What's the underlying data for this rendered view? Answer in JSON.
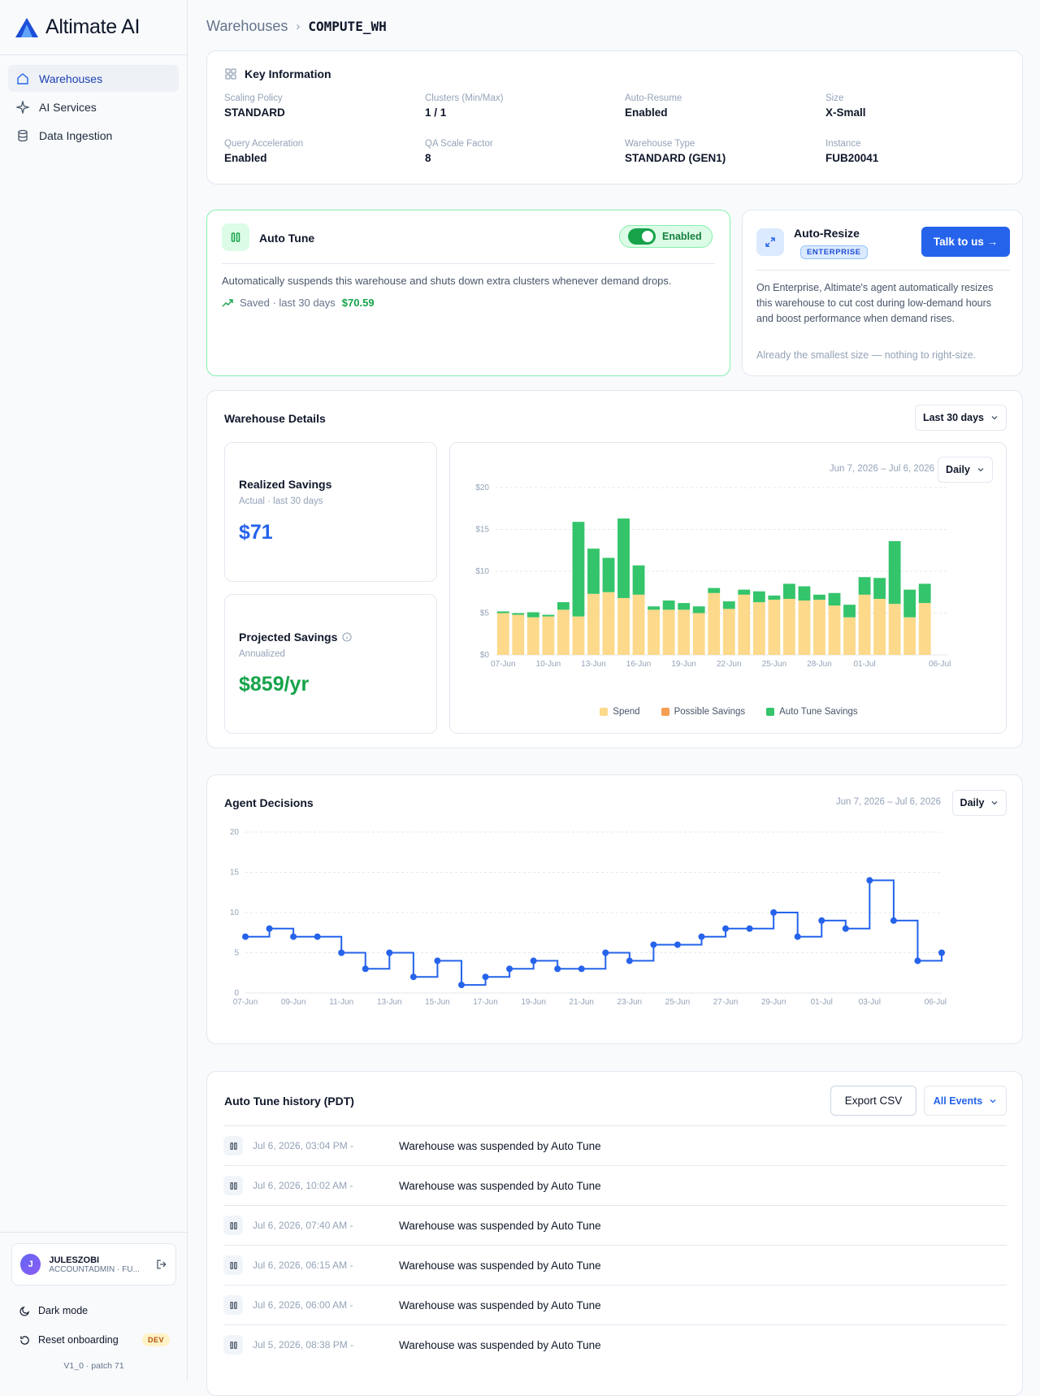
{
  "app": {
    "name": "Altimate AI"
  },
  "sidebar": {
    "items": [
      {
        "label": "Warehouses",
        "icon": "home-icon",
        "active": true
      },
      {
        "label": "AI Services",
        "icon": "sparkle-icon",
        "active": false
      },
      {
        "label": "Data Ingestion",
        "icon": "database-icon",
        "active": false
      }
    ],
    "user": {
      "initial": "J",
      "name": "JULESZOBI",
      "role": "ACCOUNTADMIN · FU..."
    },
    "dark_mode_label": "Dark mode",
    "reset_label": "Reset onboarding",
    "dev_badge": "DEV",
    "version": "V1_0 · patch 71"
  },
  "breadcrumb": {
    "root": "Warehouses",
    "current": "COMPUTE_WH"
  },
  "key_info": {
    "title": "Key Information",
    "fields": [
      {
        "label": "Scaling Policy",
        "value": "STANDARD"
      },
      {
        "label": "Clusters (Min/Max)",
        "value": "1 / 1"
      },
      {
        "label": "Auto-Resume",
        "value": "Enabled"
      },
      {
        "label": "Size",
        "value": "X-Small"
      },
      {
        "label": "Query Acceleration",
        "value": "Enabled"
      },
      {
        "label": "QA Scale Factor",
        "value": "8"
      },
      {
        "label": "Warehouse Type",
        "value": "STANDARD (GEN1)"
      },
      {
        "label": "Instance",
        "value": "FUB20041"
      }
    ]
  },
  "auto_tune": {
    "title": "Auto Tune",
    "toggle_label": "Enabled",
    "description": "Automatically suspends this warehouse and shuts down extra clusters whenever demand drops.",
    "saved_label": "Saved · last 30 days",
    "saved_value": "$70.59"
  },
  "auto_resize": {
    "title": "Auto-Resize",
    "badge": "ENTERPRISE",
    "button": "Talk to us →",
    "description": "On Enterprise, Altimate's agent automatically resizes this warehouse to cut cost during low-demand hours and boost performance when demand rises.",
    "note": "Already the smallest size — nothing to right-size."
  },
  "details": {
    "title": "Warehouse Details",
    "range_select": "Last 30 days",
    "realized": {
      "title": "Realized Savings",
      "sub": "Actual · last 30 days",
      "value": "$71"
    },
    "projected": {
      "title": "Projected Savings",
      "sub": "Annualized",
      "value": "$859/yr"
    },
    "chart_range": "Jun 7, 2026 – Jul 6, 2026",
    "granularity": "Daily"
  },
  "decisions": {
    "title": "Agent Decisions",
    "chart_range": "Jun 7, 2026 – Jul 6, 2026",
    "granularity": "Daily"
  },
  "history": {
    "title": "Auto Tune history (PDT)",
    "export_label": "Export CSV",
    "filter_label": "All Events",
    "rows": [
      {
        "time": "Jul 6, 2026, 03:04 PM -",
        "text": "Warehouse was suspended by Auto Tune"
      },
      {
        "time": "Jul 6, 2026, 10:02 AM -",
        "text": "Warehouse was suspended by Auto Tune"
      },
      {
        "time": "Jul 6, 2026, 07:40 AM -",
        "text": "Warehouse was suspended by Auto Tune"
      },
      {
        "time": "Jul 6, 2026, 06:15 AM -",
        "text": "Warehouse was suspended by Auto Tune"
      },
      {
        "time": "Jul 6, 2026, 06:00 AM -",
        "text": "Warehouse was suspended by Auto Tune"
      },
      {
        "time": "Jul 5, 2026, 08:38 PM -",
        "text": "Warehouse was suspended by Auto Tune"
      }
    ]
  },
  "colors": {
    "accent": "#2563eb",
    "spend": "#fcd98b",
    "possible": "#f59e52",
    "autotune": "#34c46b",
    "line": "#2563eb"
  },
  "chart_data": [
    {
      "type": "bar",
      "stacked": true,
      "categories": [
        "07-Jun",
        "08-Jun",
        "09-Jun",
        "10-Jun",
        "11-Jun",
        "12-Jun",
        "13-Jun",
        "14-Jun",
        "15-Jun",
        "16-Jun",
        "17-Jun",
        "18-Jun",
        "19-Jun",
        "20-Jun",
        "21-Jun",
        "22-Jun",
        "23-Jun",
        "24-Jun",
        "25-Jun",
        "26-Jun",
        "27-Jun",
        "28-Jun",
        "29-Jun",
        "30-Jun",
        "01-Jul",
        "02-Jul",
        "03-Jul",
        "04-Jul",
        "05-Jul",
        "06-Jul"
      ],
      "tick_labels": [
        "07-Jun",
        "10-Jun",
        "13-Jun",
        "16-Jun",
        "19-Jun",
        "22-Jun",
        "25-Jun",
        "28-Jun",
        "01-Jul",
        "06-Jul"
      ],
      "series": [
        {
          "name": "Spend",
          "values": [
            5.0,
            4.8,
            4.5,
            4.6,
            5.4,
            4.6,
            7.3,
            7.5,
            6.8,
            7.2,
            5.4,
            5.4,
            5.4,
            5.0,
            7.4,
            5.5,
            7.2,
            6.3,
            6.6,
            6.7,
            6.5,
            6.6,
            5.9,
            4.5,
            7.2,
            6.7,
            6.1,
            4.5,
            6.2,
            0
          ]
        },
        {
          "name": "Possible Savings",
          "values": [
            0,
            0,
            0,
            0,
            0,
            0,
            0,
            0,
            0,
            0,
            0,
            0,
            0,
            0,
            0,
            0,
            0,
            0,
            0,
            0,
            0,
            0,
            0,
            0,
            0,
            0,
            0,
            0,
            0,
            0
          ]
        },
        {
          "name": "Auto Tune Savings",
          "values": [
            0.2,
            0.2,
            0.6,
            0.2,
            0.9,
            11.3,
            5.4,
            4.1,
            9.5,
            3.5,
            0.4,
            1.1,
            0.8,
            0.8,
            0.6,
            0.9,
            0.6,
            1.3,
            0.5,
            1.8,
            1.7,
            0.6,
            1.5,
            1.5,
            2.1,
            2.5,
            7.5,
            3.3,
            2.3,
            0
          ]
        }
      ],
      "ylim": [
        0,
        20
      ],
      "yticks": [
        "$0",
        "$5",
        "$10",
        "$15",
        "$20"
      ],
      "legend": "bottom"
    },
    {
      "type": "line",
      "step": true,
      "x": [
        "07-Jun",
        "08-Jun",
        "09-Jun",
        "10-Jun",
        "11-Jun",
        "12-Jun",
        "13-Jun",
        "14-Jun",
        "15-Jun",
        "16-Jun",
        "17-Jun",
        "18-Jun",
        "19-Jun",
        "20-Jun",
        "21-Jun",
        "22-Jun",
        "23-Jun",
        "24-Jun",
        "25-Jun",
        "26-Jun",
        "27-Jun",
        "28-Jun",
        "29-Jun",
        "30-Jun",
        "01-Jul",
        "02-Jul",
        "03-Jul",
        "04-Jul",
        "05-Jul",
        "06-Jul"
      ],
      "tick_labels": [
        "07-Jun",
        "09-Jun",
        "11-Jun",
        "13-Jun",
        "15-Jun",
        "17-Jun",
        "19-Jun",
        "21-Jun",
        "23-Jun",
        "25-Jun",
        "27-Jun",
        "29-Jun",
        "01-Jul",
        "03-Jul",
        "06-Jul"
      ],
      "values": [
        7,
        8,
        7,
        7,
        5,
        3,
        5,
        2,
        4,
        1,
        2,
        3,
        4,
        3,
        3,
        5,
        4,
        6,
        6,
        7,
        8,
        8,
        10,
        7,
        9,
        8,
        14,
        9,
        4,
        5
      ],
      "ylim": [
        0,
        20
      ],
      "yticks": [
        "0",
        "5",
        "10",
        "15",
        "20"
      ]
    }
  ]
}
